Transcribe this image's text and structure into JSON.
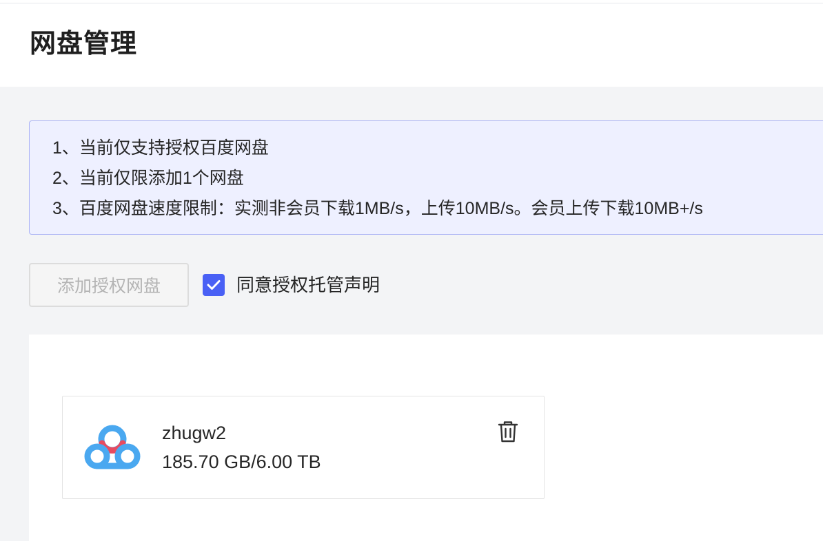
{
  "header": {
    "title": "网盘管理"
  },
  "notice": {
    "lines": [
      "1、当前仅支持授权百度网盘",
      "2、当前仅限添加1个网盘",
      "3、百度网盘速度限制：实测非会员下载1MB/s，上传10MB/s。会员上传下载10MB+/s"
    ]
  },
  "actions": {
    "add_label": "添加授权网盘",
    "add_disabled": true,
    "agree_label": "同意授权托管声明",
    "agree_checked": true
  },
  "disks": [
    {
      "name": "zhugw2",
      "usage": "185.70 GB/6.00 TB",
      "icon": "baidu-netdisk-icon",
      "delete_icon": "trash-icon"
    }
  ],
  "colors": {
    "accent": "#4960f5",
    "notice_bg": "#eef0ff",
    "notice_border": "#a9b2f5",
    "page_bg": "#f3f4f6",
    "baidu_blue": "#4aa8f0",
    "baidu_red": "#e84b5f"
  }
}
